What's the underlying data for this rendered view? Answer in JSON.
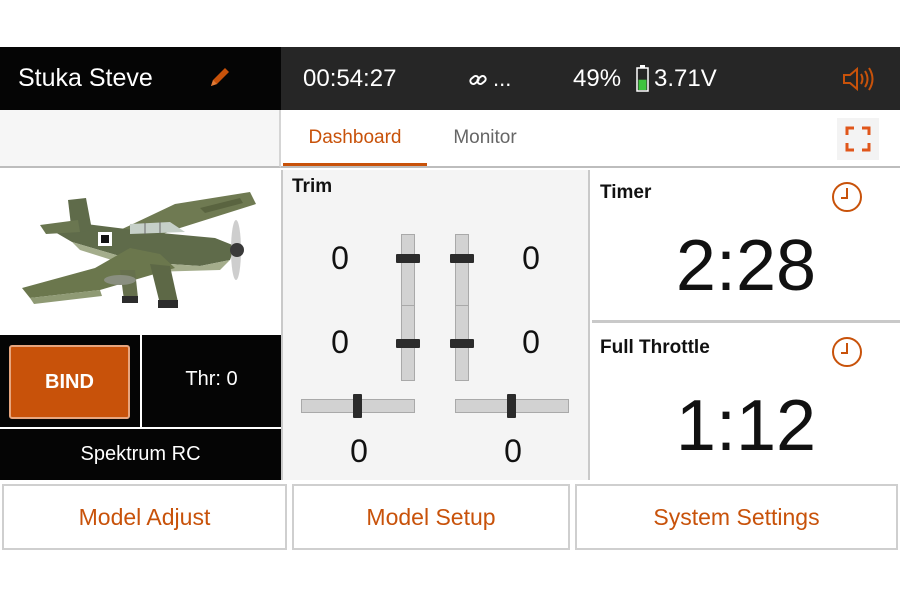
{
  "header": {
    "model_name": "Stuka Steve",
    "edit_icon": "pencil-icon",
    "elapsed_time": "00:54:27",
    "link_label": "...",
    "link_icon": "link-icon",
    "battery_percent": "49%",
    "battery_level": 0.49,
    "voltage": "3.71V",
    "sound_icon": "speaker-volume-icon"
  },
  "tabs": [
    {
      "label": "Dashboard",
      "active": true
    },
    {
      "label": "Monitor",
      "active": false
    }
  ],
  "fullscreen_icon": "fullscreen-icon",
  "left_panel": {
    "image": "stuka-airplane-image",
    "bind_label": "BIND",
    "throttle_label": "Thr: 0",
    "brand_label": "Spektrum RC"
  },
  "trim": {
    "title": "Trim",
    "left_upper": "0",
    "right_upper": "0",
    "left_lower": "0",
    "right_lower": "0",
    "bottom_left": "0",
    "bottom_right": "0"
  },
  "timers": [
    {
      "label": "Timer",
      "value": "2:28",
      "icon": "clock-icon"
    },
    {
      "label": "Full Throttle",
      "value": "1:12",
      "icon": "clock-icon"
    }
  ],
  "bottom_buttons": {
    "model_adjust": "Model Adjust",
    "model_setup": "Model Setup",
    "system_settings": "System Settings"
  },
  "colors": {
    "accent": "#c8520a",
    "battery_green": "#3ec43e",
    "header_bg": "#262626"
  }
}
